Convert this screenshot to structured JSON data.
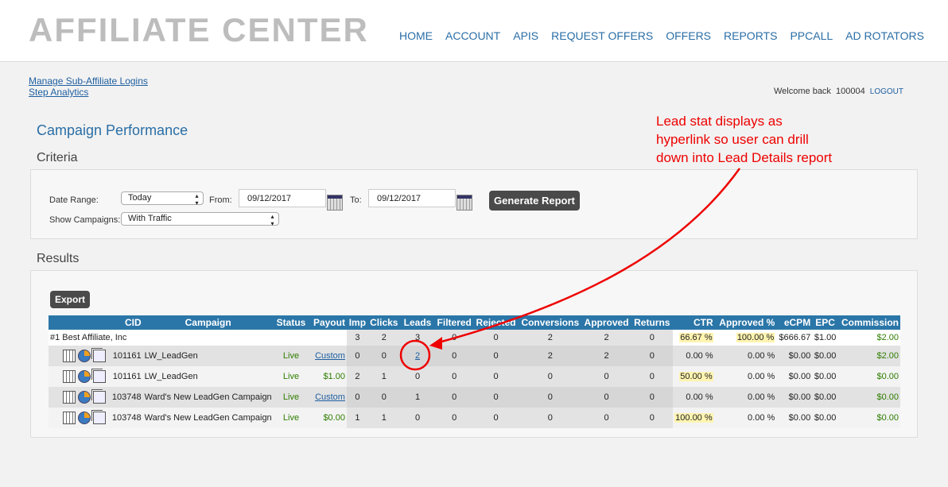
{
  "header": {
    "logo": "AFFILIATE CENTER",
    "nav": [
      "HOME",
      "ACCOUNT",
      "APIS",
      "REQUEST OFFERS",
      "OFFERS",
      "REPORTS",
      "PPCALL",
      "AD ROTATORS"
    ]
  },
  "links": [
    "Manage Sub-Affiliate Logins",
    "Step Analytics"
  ],
  "welcome": {
    "text": "Welcome back  100004",
    "logout": "LOGOUT"
  },
  "page_title": "Campaign Performance",
  "criteria": {
    "title": "Criteria",
    "date_range_label": "Date Range:",
    "date_range_value": "Today",
    "from_label": "From:",
    "from_value": "09/12/2017",
    "to_label": "To:",
    "to_value": "09/12/2017",
    "show_label": "Show Campaigns:",
    "show_value": "With Traffic",
    "generate": "Generate Report"
  },
  "results": {
    "title": "Results",
    "export": "Export",
    "columns": [
      "",
      "CID",
      "Campaign",
      "Status",
      "Payout",
      "Imp",
      "Clicks",
      "Leads",
      "Filtered",
      "Rejected",
      "Conversions",
      "Approved",
      "Returns",
      "CTR",
      "Approved %",
      "eCPM",
      "EPC",
      "Commission"
    ],
    "account_row": {
      "name": "#1 Best Affiliate, Inc",
      "imp": "3",
      "clicks": "2",
      "leads": "3",
      "filtered": "0",
      "rejected": "0",
      "conversions": "2",
      "approved": "2",
      "returns": "0",
      "ctr": "66.67 %",
      "approved_pct": "100.00 %",
      "ecpm": "$666.67",
      "epc": "$1.00",
      "commission": "$2.00"
    },
    "rows": [
      {
        "cid": "101161",
        "campaign": "LW_LeadGen",
        "status": "Live",
        "payout": "Custom",
        "payout_link": true,
        "imp": "0",
        "clicks": "0",
        "leads": "2",
        "leads_link": true,
        "filtered": "0",
        "rejected": "0",
        "conversions": "2",
        "approved": "2",
        "returns": "0",
        "ctr": "0.00 %",
        "approved_pct": "0.00 %",
        "ecpm": "$0.00",
        "epc": "$0.00",
        "commission": "$2.00"
      },
      {
        "cid": "101161",
        "campaign": "LW_LeadGen",
        "status": "Live",
        "payout": "$1.00",
        "imp": "2",
        "clicks": "1",
        "leads": "0",
        "filtered": "0",
        "rejected": "0",
        "conversions": "0",
        "approved": "0",
        "returns": "0",
        "ctr": "50.00 %",
        "ctr_hl": true,
        "approved_pct": "0.00 %",
        "ecpm": "$0.00",
        "epc": "$0.00",
        "commission": "$0.00"
      },
      {
        "cid": "103748",
        "campaign": "Ward's New LeadGen Campaign",
        "status": "Live",
        "payout": "Custom",
        "payout_link": true,
        "imp": "0",
        "clicks": "0",
        "leads": "1",
        "filtered": "0",
        "rejected": "0",
        "conversions": "0",
        "approved": "0",
        "returns": "0",
        "ctr": "0.00 %",
        "approved_pct": "0.00 %",
        "ecpm": "$0.00",
        "epc": "$0.00",
        "commission": "$0.00"
      },
      {
        "cid": "103748",
        "campaign": "Ward's New LeadGen Campaign",
        "status": "Live",
        "payout": "$0.00",
        "imp": "1",
        "clicks": "1",
        "leads": "0",
        "filtered": "0",
        "rejected": "0",
        "conversions": "0",
        "approved": "0",
        "returns": "0",
        "ctr": "100.00 %",
        "ctr_hl": true,
        "approved_pct": "0.00 %",
        "ecpm": "$0.00",
        "epc": "$0.00",
        "commission": "$0.00"
      }
    ]
  },
  "annotation": {
    "lines": [
      "Lead stat displays as",
      "hyperlink so user can drill",
      "down into Lead Details report"
    ],
    "color": "#e00000"
  }
}
